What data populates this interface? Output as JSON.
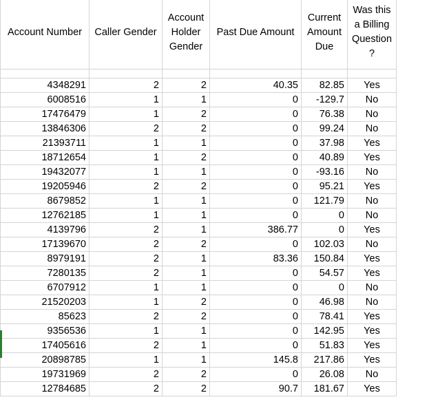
{
  "headers": {
    "account_number": "Account Number",
    "caller_gender": "Caller Gender",
    "account_holder_gender": "Account Holder Gender",
    "past_due_amount": "Past Due Amount",
    "current_amount_due": "Current Amount Due",
    "billing_question": "Was this a Billing Question ?"
  },
  "rows": [
    [
      "4348291",
      "2",
      "2",
      "40.35",
      "82.85",
      "Yes"
    ],
    [
      "6008516",
      "1",
      "1",
      "0",
      "-129.7",
      "No"
    ],
    [
      "17476479",
      "1",
      "2",
      "0",
      "76.38",
      "No"
    ],
    [
      "13846306",
      "2",
      "2",
      "0",
      "99.24",
      "No"
    ],
    [
      "21393711",
      "1",
      "1",
      "0",
      "37.98",
      "Yes"
    ],
    [
      "18712654",
      "1",
      "2",
      "0",
      "40.89",
      "Yes"
    ],
    [
      "19432077",
      "1",
      "1",
      "0",
      "-93.16",
      "No"
    ],
    [
      "19205946",
      "2",
      "2",
      "0",
      "95.21",
      "Yes"
    ],
    [
      "8679852",
      "1",
      "1",
      "0",
      "121.79",
      "No"
    ],
    [
      "12762185",
      "1",
      "1",
      "0",
      "0",
      "No"
    ],
    [
      "4139796",
      "2",
      "1",
      "386.77",
      "0",
      "Yes"
    ],
    [
      "17139670",
      "2",
      "2",
      "0",
      "102.03",
      "No"
    ],
    [
      "8979191",
      "2",
      "1",
      "83.36",
      "150.84",
      "Yes"
    ],
    [
      "7280135",
      "2",
      "1",
      "0",
      "54.57",
      "Yes"
    ],
    [
      "6707912",
      "1",
      "1",
      "0",
      "0",
      "No"
    ],
    [
      "21520203",
      "1",
      "2",
      "0",
      "46.98",
      "No"
    ],
    [
      "85623",
      "2",
      "2",
      "0",
      "78.41",
      "Yes"
    ],
    [
      "9356536",
      "1",
      "1",
      "0",
      "142.95",
      "Yes"
    ],
    [
      "17405616",
      "2",
      "1",
      "0",
      "51.83",
      "Yes"
    ],
    [
      "20898785",
      "1",
      "1",
      "145.8",
      "217.86",
      "Yes"
    ],
    [
      "19731969",
      "2",
      "2",
      "0",
      "26.08",
      "No"
    ],
    [
      "12784685",
      "2",
      "2",
      "90.7",
      "181.67",
      "Yes"
    ]
  ]
}
